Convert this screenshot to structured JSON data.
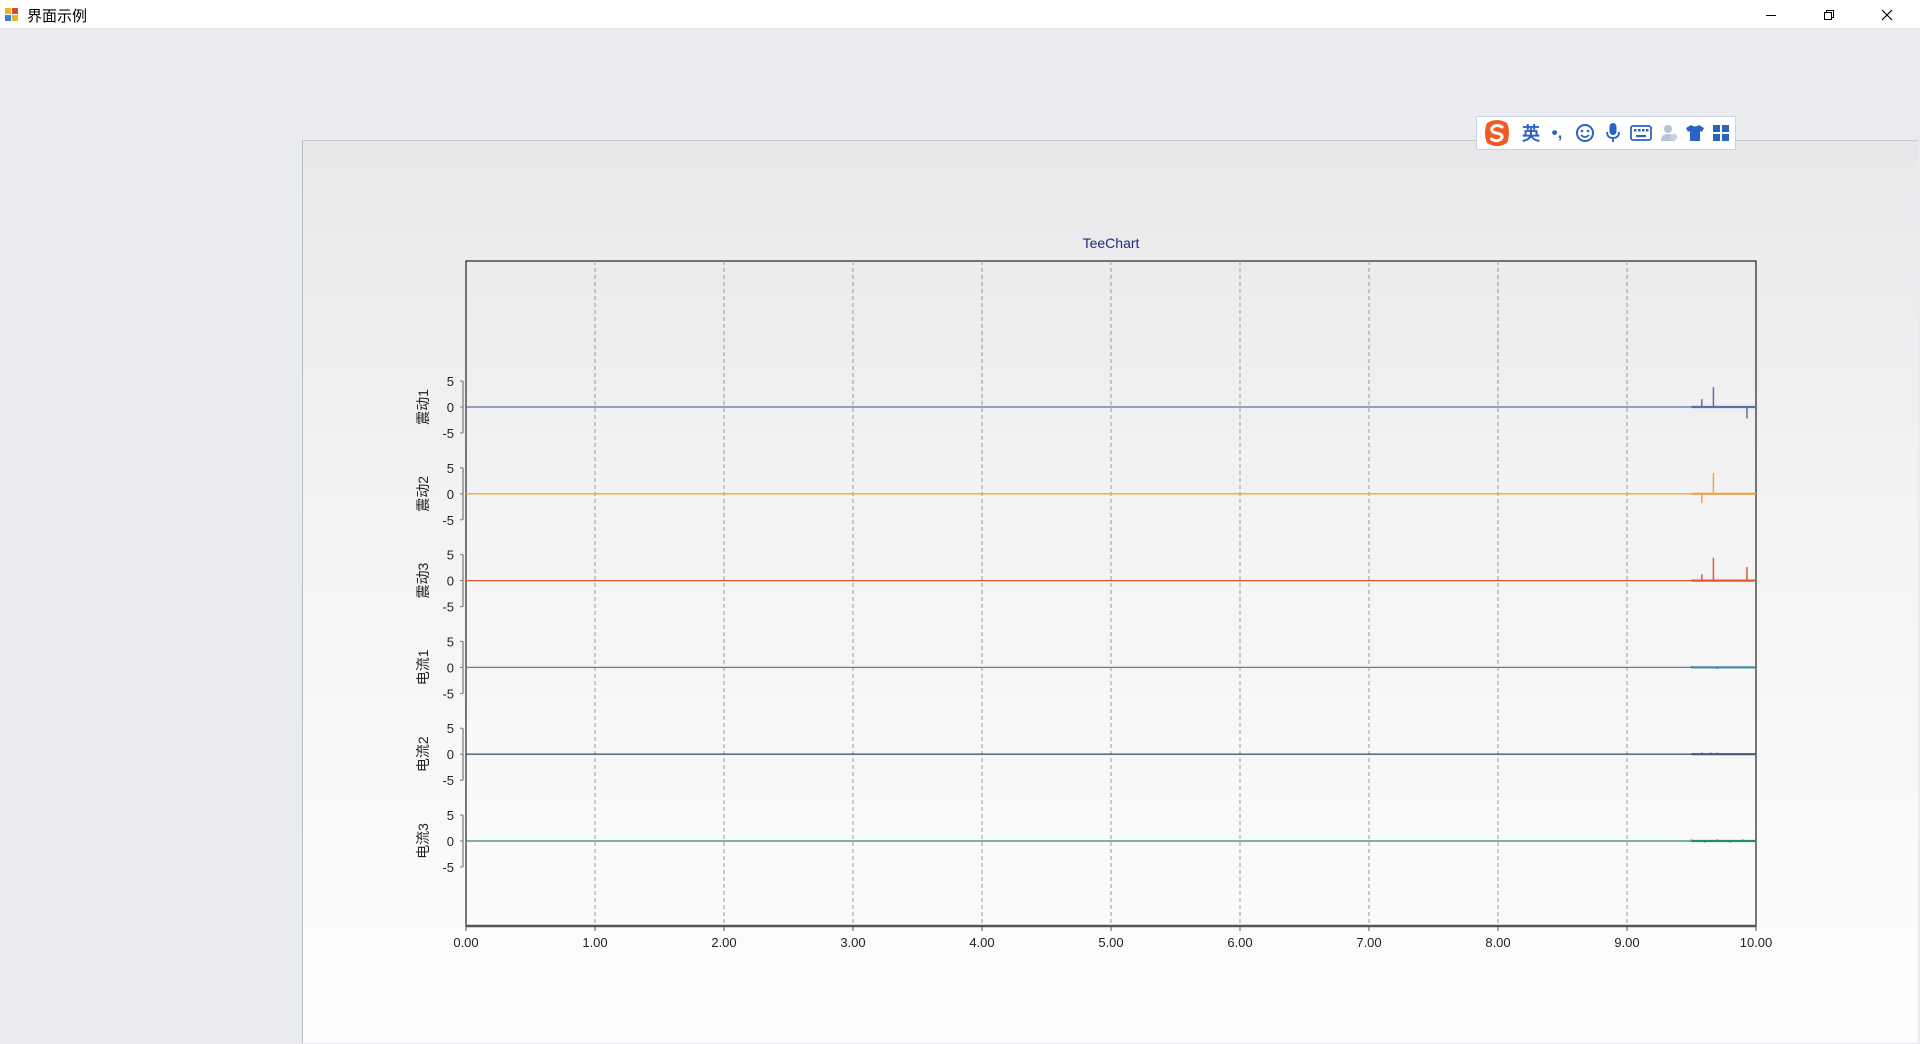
{
  "window": {
    "title": "界面示例",
    "controls": [
      "minimize",
      "restore",
      "close"
    ]
  },
  "ime_toolbar": {
    "logo": "sogou-s-logo",
    "language": "英",
    "punctuation": "•,",
    "icons": [
      "smiley-icon",
      "microphone-icon",
      "keyboard-icon",
      "user-icon",
      "shirt-icon",
      "grid-icon"
    ]
  },
  "chart_data": {
    "type": "line",
    "title": "TeeChart",
    "x_ticks": [
      "0.00",
      "1.00",
      "2.00",
      "3.00",
      "4.00",
      "5.00",
      "6.00",
      "7.00",
      "8.00",
      "9.00",
      "10.00"
    ],
    "xlim": [
      0,
      10
    ],
    "ylim": [
      -5,
      5
    ],
    "y_ticks": [
      "5",
      "0",
      "-5"
    ],
    "grid": true,
    "series": [
      {
        "name": "震动1",
        "color": "#5b6fa6",
        "baseline": 0,
        "spikes": [
          {
            "x": 9.58,
            "y": 1.5
          },
          {
            "x": 9.67,
            "y": 3.8
          },
          {
            "x": 9.93,
            "y": -2.2
          }
        ]
      },
      {
        "name": "震动2",
        "color": "#f0a441",
        "baseline": 0,
        "spikes": [
          {
            "x": 9.58,
            "y": -1.8
          },
          {
            "x": 9.67,
            "y": 4.0
          }
        ]
      },
      {
        "name": "震动3",
        "color": "#e05a2b",
        "baseline": 0,
        "spikes": [
          {
            "x": 9.58,
            "y": 1.2
          },
          {
            "x": 9.67,
            "y": 4.4
          },
          {
            "x": 9.93,
            "y": 2.6
          }
        ]
      },
      {
        "name": "电流1",
        "color": "#4a8aa0",
        "baseline": 0,
        "spikes": [
          {
            "x": 9.5,
            "y": 0.3
          },
          {
            "x": 9.7,
            "y": -0.3
          }
        ]
      },
      {
        "name": "电流2",
        "color": "#3d5b80",
        "baseline": 0,
        "spikes": [
          {
            "x": 9.58,
            "y": 0.3
          },
          {
            "x": 9.65,
            "y": 0.3
          },
          {
            "x": 9.7,
            "y": 0.3
          }
        ]
      },
      {
        "name": "电流3",
        "color": "#2d8a5f",
        "baseline": 0,
        "spikes": [
          {
            "x": 9.5,
            "y": 0.3
          },
          {
            "x": 9.6,
            "y": -0.3
          },
          {
            "x": 9.7,
            "y": 0.3
          },
          {
            "x": 9.8,
            "y": -0.3
          },
          {
            "x": 9.9,
            "y": 0.3
          }
        ]
      }
    ]
  }
}
